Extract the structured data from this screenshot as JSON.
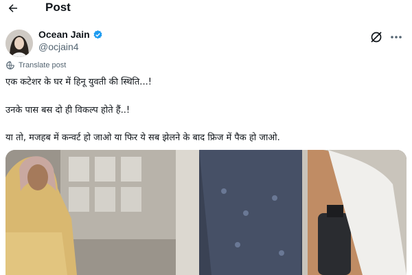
{
  "header": {
    "back_icon": "arrow-left-icon",
    "title": "Post"
  },
  "author": {
    "name": "Ocean Jain",
    "handle": "@ocjain4",
    "verified_color": "#1d9bf0"
  },
  "actions": {
    "grok_icon": "grok-icon",
    "more_icon": "more-horizontal-icon"
  },
  "translate": {
    "label": "Translate post",
    "icon": "translate-icon",
    "color": "#536471"
  },
  "tweet": {
    "lines": [
      "एक कटेशर के घर में हिनू युवती की स्थिति...!",
      "उनके पास बस दो ही विकल्प होते हैं..!",
      "या तो, मजहब में कन्वर्ट हो जाओ या फिर ये सब झेलने के बाद फ्रिज में पैक हो जाओ."
    ]
  },
  "media": {
    "kind": "video-thumbnail"
  }
}
